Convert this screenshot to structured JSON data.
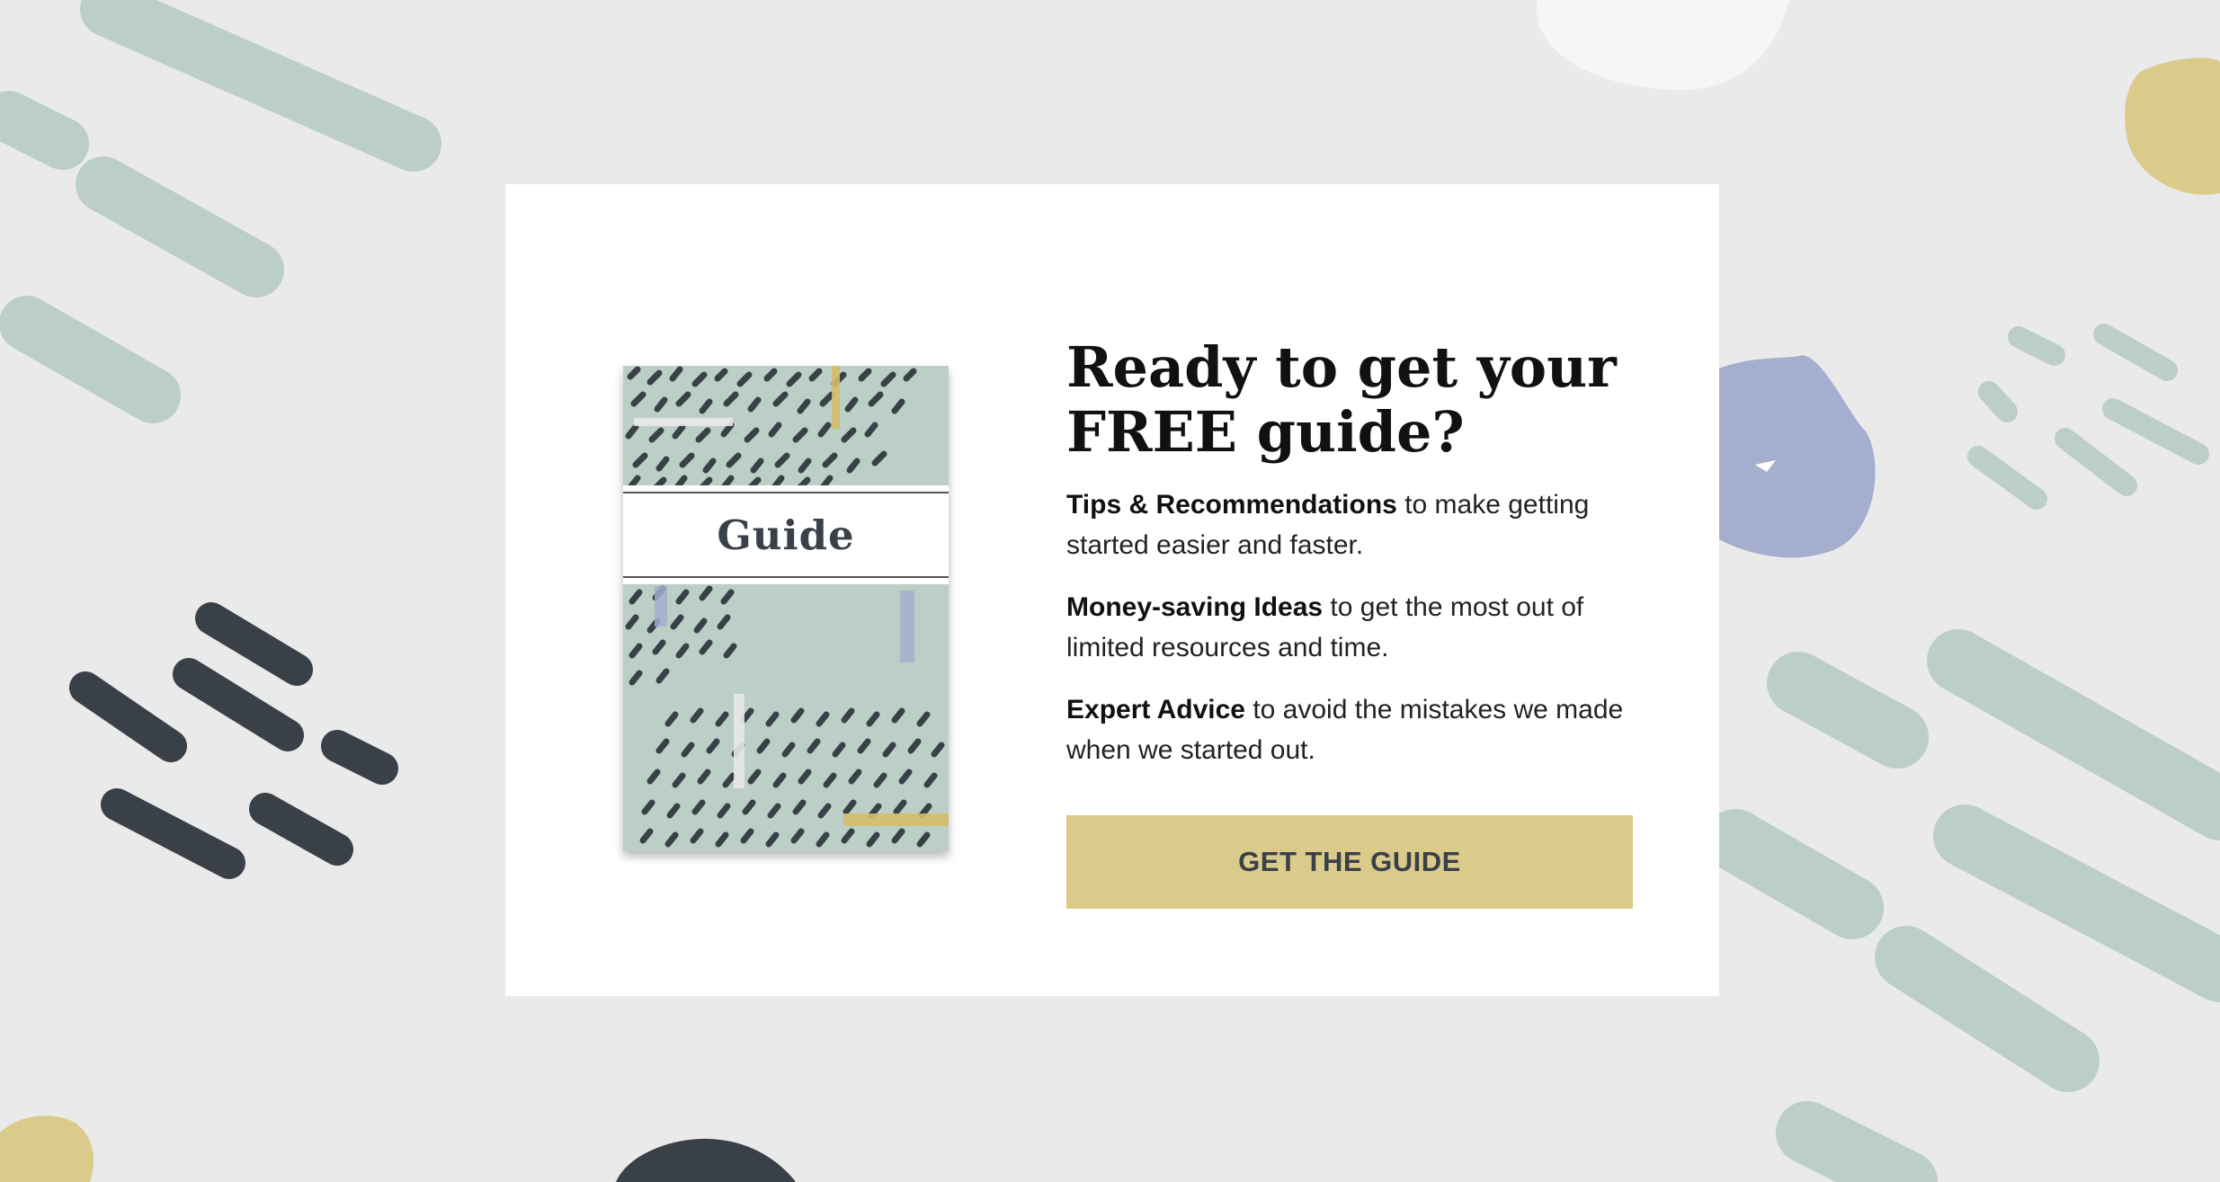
{
  "book": {
    "title": "Guide"
  },
  "content": {
    "headline_line1": "Ready to get your",
    "headline_line2": "FREE guide?",
    "benefits": [
      {
        "bold": "Tips & Recommendations",
        "text": " to make getting started easier and faster."
      },
      {
        "bold": "Money-saving Ideas",
        "text": " to get the most out of limited resources and time."
      },
      {
        "bold": "Expert Advice",
        "text": " to avoid the mistakes we made when we started out."
      }
    ]
  },
  "cta": {
    "label": "GET THE GUIDE"
  },
  "colors": {
    "background": "#eaeaea",
    "sage": "#bccfc6",
    "charcoal": "#3a4047",
    "mustard": "#dbcb8b",
    "periwinkle": "#a5aece"
  }
}
